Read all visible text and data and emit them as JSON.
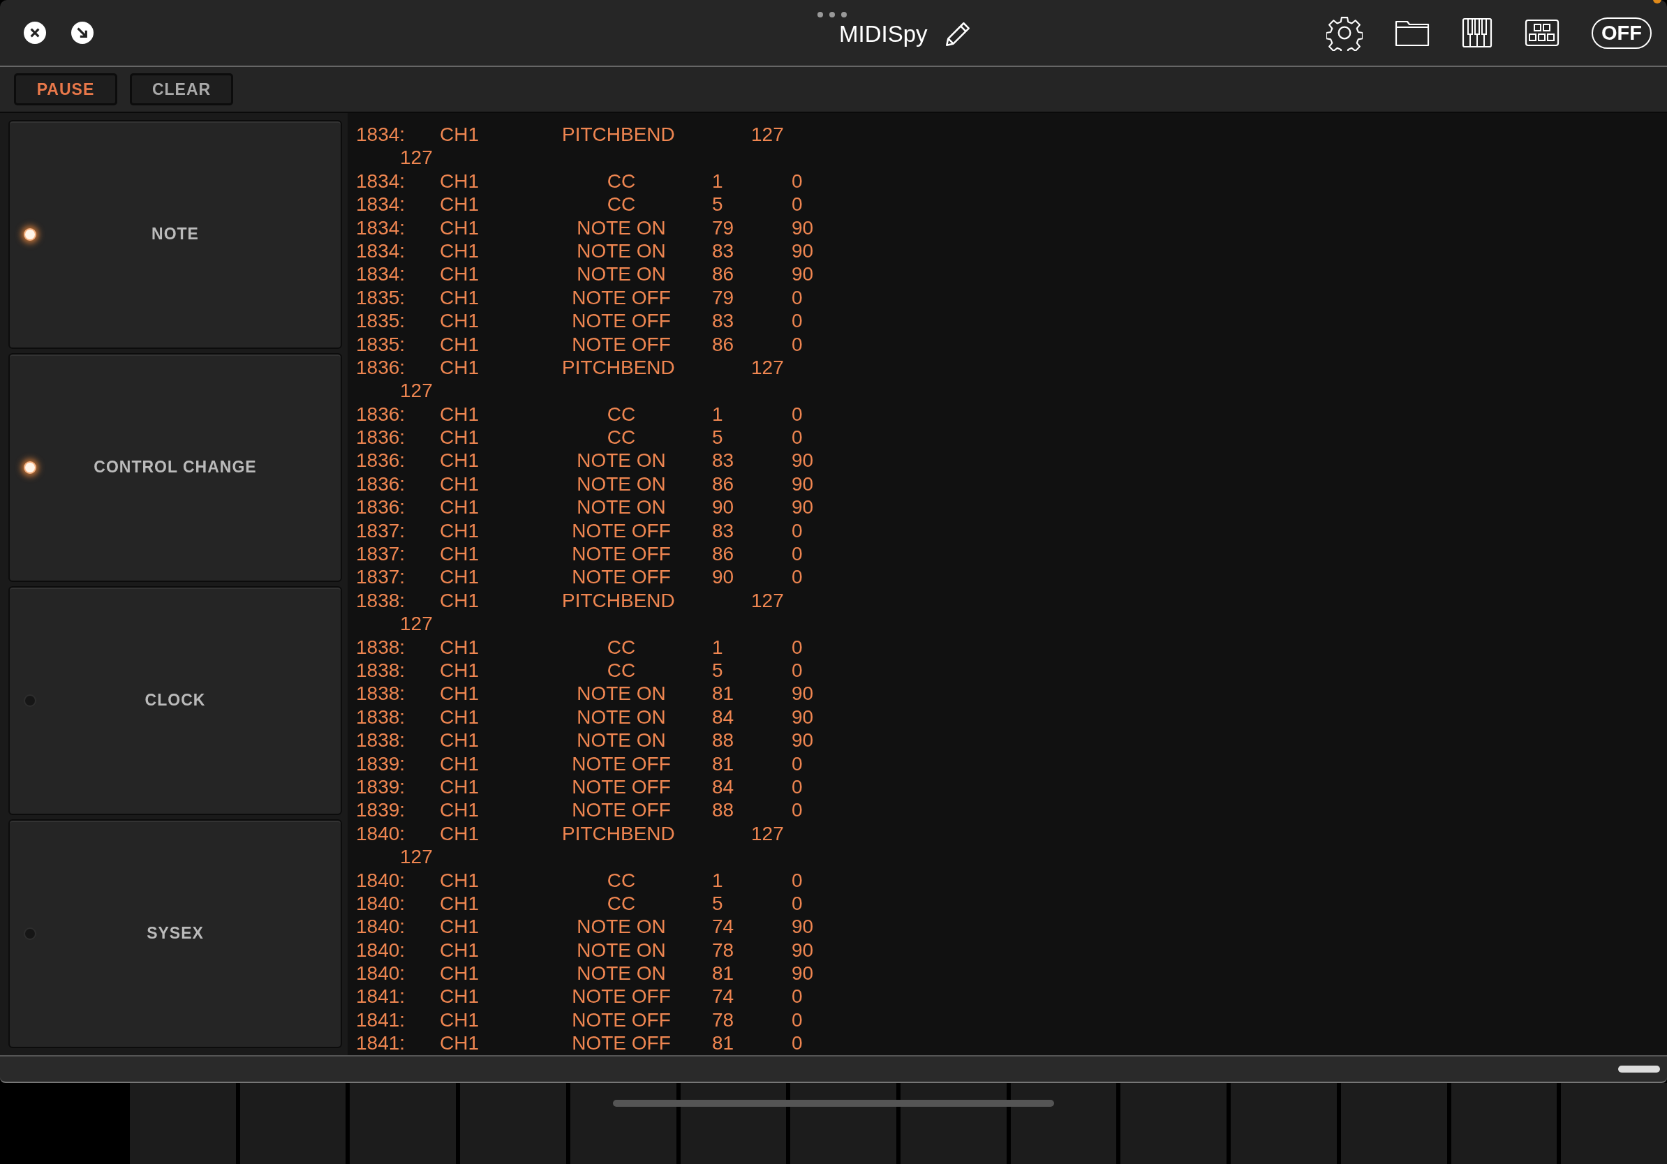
{
  "window": {
    "title": "MIDISpy"
  },
  "toolbar": {
    "power_button": "OFF",
    "buttons": [
      {
        "label": "PAUSE",
        "active": true
      },
      {
        "label": "CLEAR",
        "active": false
      }
    ]
  },
  "filters": [
    {
      "label": "NOTE",
      "on": true
    },
    {
      "label": "CONTROL CHANGE",
      "on": true
    },
    {
      "label": "CLOCK",
      "on": false
    },
    {
      "label": "SYSEX",
      "on": false
    }
  ],
  "log": [
    {
      "kind": "pitchbend",
      "time": "1834:",
      "channel": "CH1",
      "type": "PITCHBEND",
      "data1": "127",
      "wrap": "127"
    },
    {
      "kind": "event",
      "time": "1834:",
      "channel": "CH1",
      "type": "CC",
      "data1": "1",
      "data2": "0"
    },
    {
      "kind": "event",
      "time": "1834:",
      "channel": "CH1",
      "type": "CC",
      "data1": "5",
      "data2": "0"
    },
    {
      "kind": "event",
      "time": "1834:",
      "channel": "CH1",
      "type": "NOTE ON",
      "data1": "79",
      "data2": "90"
    },
    {
      "kind": "event",
      "time": "1834:",
      "channel": "CH1",
      "type": "NOTE ON",
      "data1": "83",
      "data2": "90"
    },
    {
      "kind": "event",
      "time": "1834:",
      "channel": "CH1",
      "type": "NOTE ON",
      "data1": "86",
      "data2": "90"
    },
    {
      "kind": "event",
      "time": "1835:",
      "channel": "CH1",
      "type": "NOTE OFF",
      "data1": "79",
      "data2": "0"
    },
    {
      "kind": "event",
      "time": "1835:",
      "channel": "CH1",
      "type": "NOTE OFF",
      "data1": "83",
      "data2": "0"
    },
    {
      "kind": "event",
      "time": "1835:",
      "channel": "CH1",
      "type": "NOTE OFF",
      "data1": "86",
      "data2": "0"
    },
    {
      "kind": "pitchbend",
      "time": "1836:",
      "channel": "CH1",
      "type": "PITCHBEND",
      "data1": "127",
      "wrap": "127"
    },
    {
      "kind": "event",
      "time": "1836:",
      "channel": "CH1",
      "type": "CC",
      "data1": "1",
      "data2": "0"
    },
    {
      "kind": "event",
      "time": "1836:",
      "channel": "CH1",
      "type": "CC",
      "data1": "5",
      "data2": "0"
    },
    {
      "kind": "event",
      "time": "1836:",
      "channel": "CH1",
      "type": "NOTE ON",
      "data1": "83",
      "data2": "90"
    },
    {
      "kind": "event",
      "time": "1836:",
      "channel": "CH1",
      "type": "NOTE ON",
      "data1": "86",
      "data2": "90"
    },
    {
      "kind": "event",
      "time": "1836:",
      "channel": "CH1",
      "type": "NOTE ON",
      "data1": "90",
      "data2": "90"
    },
    {
      "kind": "event",
      "time": "1837:",
      "channel": "CH1",
      "type": "NOTE OFF",
      "data1": "83",
      "data2": "0"
    },
    {
      "kind": "event",
      "time": "1837:",
      "channel": "CH1",
      "type": "NOTE OFF",
      "data1": "86",
      "data2": "0"
    },
    {
      "kind": "event",
      "time": "1837:",
      "channel": "CH1",
      "type": "NOTE OFF",
      "data1": "90",
      "data2": "0"
    },
    {
      "kind": "pitchbend",
      "time": "1838:",
      "channel": "CH1",
      "type": "PITCHBEND",
      "data1": "127",
      "wrap": "127"
    },
    {
      "kind": "event",
      "time": "1838:",
      "channel": "CH1",
      "type": "CC",
      "data1": "1",
      "data2": "0"
    },
    {
      "kind": "event",
      "time": "1838:",
      "channel": "CH1",
      "type": "CC",
      "data1": "5",
      "data2": "0"
    },
    {
      "kind": "event",
      "time": "1838:",
      "channel": "CH1",
      "type": "NOTE ON",
      "data1": "81",
      "data2": "90"
    },
    {
      "kind": "event",
      "time": "1838:",
      "channel": "CH1",
      "type": "NOTE ON",
      "data1": "84",
      "data2": "90"
    },
    {
      "kind": "event",
      "time": "1838:",
      "channel": "CH1",
      "type": "NOTE ON",
      "data1": "88",
      "data2": "90"
    },
    {
      "kind": "event",
      "time": "1839:",
      "channel": "CH1",
      "type": "NOTE OFF",
      "data1": "81",
      "data2": "0"
    },
    {
      "kind": "event",
      "time": "1839:",
      "channel": "CH1",
      "type": "NOTE OFF",
      "data1": "84",
      "data2": "0"
    },
    {
      "kind": "event",
      "time": "1839:",
      "channel": "CH1",
      "type": "NOTE OFF",
      "data1": "88",
      "data2": "0"
    },
    {
      "kind": "pitchbend",
      "time": "1840:",
      "channel": "CH1",
      "type": "PITCHBEND",
      "data1": "127",
      "wrap": "127"
    },
    {
      "kind": "event",
      "time": "1840:",
      "channel": "CH1",
      "type": "CC",
      "data1": "1",
      "data2": "0"
    },
    {
      "kind": "event",
      "time": "1840:",
      "channel": "CH1",
      "type": "CC",
      "data1": "5",
      "data2": "0"
    },
    {
      "kind": "event",
      "time": "1840:",
      "channel": "CH1",
      "type": "NOTE ON",
      "data1": "74",
      "data2": "90"
    },
    {
      "kind": "event",
      "time": "1840:",
      "channel": "CH1",
      "type": "NOTE ON",
      "data1": "78",
      "data2": "90"
    },
    {
      "kind": "event",
      "time": "1840:",
      "channel": "CH1",
      "type": "NOTE ON",
      "data1": "81",
      "data2": "90"
    },
    {
      "kind": "event",
      "time": "1841:",
      "channel": "CH1",
      "type": "NOTE OFF",
      "data1": "74",
      "data2": "0"
    },
    {
      "kind": "event",
      "time": "1841:",
      "channel": "CH1",
      "type": "NOTE OFF",
      "data1": "78",
      "data2": "0"
    },
    {
      "kind": "event",
      "time": "1841:",
      "channel": "CH1",
      "type": "NOTE OFF",
      "data1": "81",
      "data2": "0"
    }
  ]
}
